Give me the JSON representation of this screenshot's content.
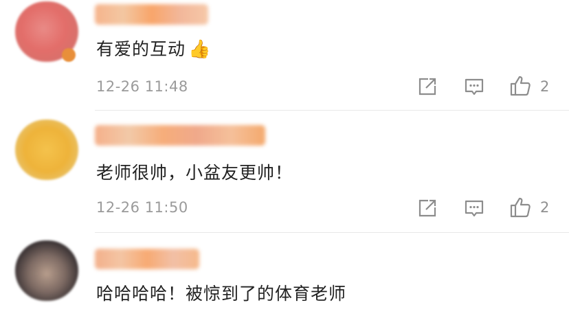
{
  "comments": [
    {
      "text": "有爱的互动",
      "emoji": "👍",
      "time": "12-26 11:48",
      "likes": "2"
    },
    {
      "text": "老师很帅，小盆友更帅！",
      "time": "12-26 11:50",
      "likes": "2"
    },
    {
      "text": "哈哈哈哈！被惊到了的体育老师"
    }
  ],
  "icons": {
    "share": "share-icon",
    "reply": "comment-icon",
    "like": "thumbs-up-icon"
  },
  "colors": {
    "text": "#222222",
    "meta": "#9a9a9a",
    "icon": "#8c8c8c",
    "divider": "#e8e8e8"
  }
}
